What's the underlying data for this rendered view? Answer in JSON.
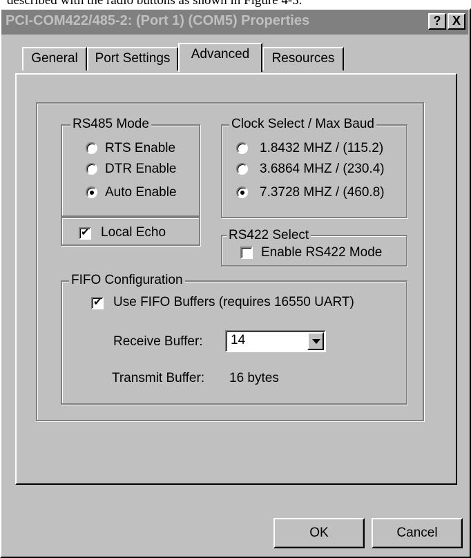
{
  "caption_fragment": "described with the radio buttons as shown in Figure 4-3.",
  "window": {
    "title": "PCI-COM422/485-2: (Port 1) (COM5) Properties",
    "help_button": "?",
    "close_button": "X"
  },
  "tabs": [
    {
      "label": "General",
      "active": false
    },
    {
      "label": "Port Settings",
      "active": false
    },
    {
      "label": "Advanced",
      "active": true
    },
    {
      "label": "Resources",
      "active": false
    }
  ],
  "rs485_mode": {
    "legend": "RS485 Mode",
    "options": [
      {
        "label": "RTS Enable",
        "selected": false
      },
      {
        "label": "DTR Enable",
        "selected": false
      },
      {
        "label": "Auto Enable",
        "selected": true
      }
    ]
  },
  "local_echo": {
    "label": "Local Echo",
    "checked": true
  },
  "clock_select": {
    "legend": "Clock Select / Max Baud",
    "options": [
      {
        "label": "1.8432 MHZ / (115.2)",
        "selected": false
      },
      {
        "label": "3.6864 MHZ / (230.4)",
        "selected": false
      },
      {
        "label": "7.3728 MHZ / (460.8)",
        "selected": true
      }
    ]
  },
  "rs422_select": {
    "legend": "RS422 Select",
    "checkbox_label": "Enable RS422 Mode",
    "checked": false
  },
  "fifo": {
    "legend": "FIFO Configuration",
    "use_fifo_label": "Use FIFO Buffers (requires 16550 UART)",
    "use_fifo_checked": true,
    "receive_label": "Receive Buffer:",
    "receive_value": "14",
    "transmit_label": "Transmit Buffer:",
    "transmit_value": "16 bytes"
  },
  "buttons": {
    "ok": "OK",
    "cancel": "Cancel"
  }
}
